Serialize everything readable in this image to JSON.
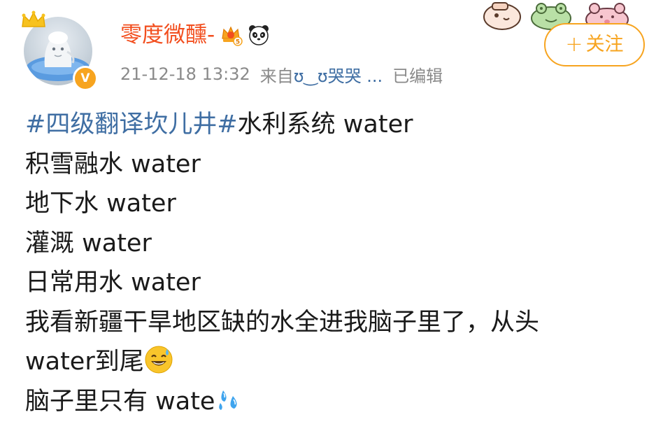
{
  "header": {
    "username": "零度微醺-",
    "timestamp": "21-12-18 13:32",
    "source_prefix": "来自",
    "source_name": "ʊ‿ʊ哭哭 ...",
    "edited_label": "已编辑"
  },
  "follow_button": {
    "plus": "+",
    "label": "关注"
  },
  "post": {
    "hashtag": "#四级翻译坎儿井#",
    "line1_rest": "水利系统 water",
    "line2": "积雪融水  water",
    "line3": "地下水 water",
    "line4": "灌溉 water",
    "line5": "日常用水 water",
    "line6": "我看新疆干旱地区缺的水全进我脑子里了，从头",
    "line7": "water到尾",
    "line8": "脑子里只有 wate"
  },
  "icons": {
    "vip_badge": "crown-vip-icon",
    "panda": "panda-icon",
    "verified": "verified-badge-icon",
    "sweat_smile": "sweat-smile-emoji",
    "sweat_droplets": "sweat-droplets-emoji",
    "stickers": "cartoon-sticker-icons"
  },
  "colors": {
    "username": "#f24e1e",
    "hashtag": "#3f6ea3",
    "accent": "#f7a41f",
    "meta": "#8a8a8a",
    "text": "#1a1a1a"
  }
}
